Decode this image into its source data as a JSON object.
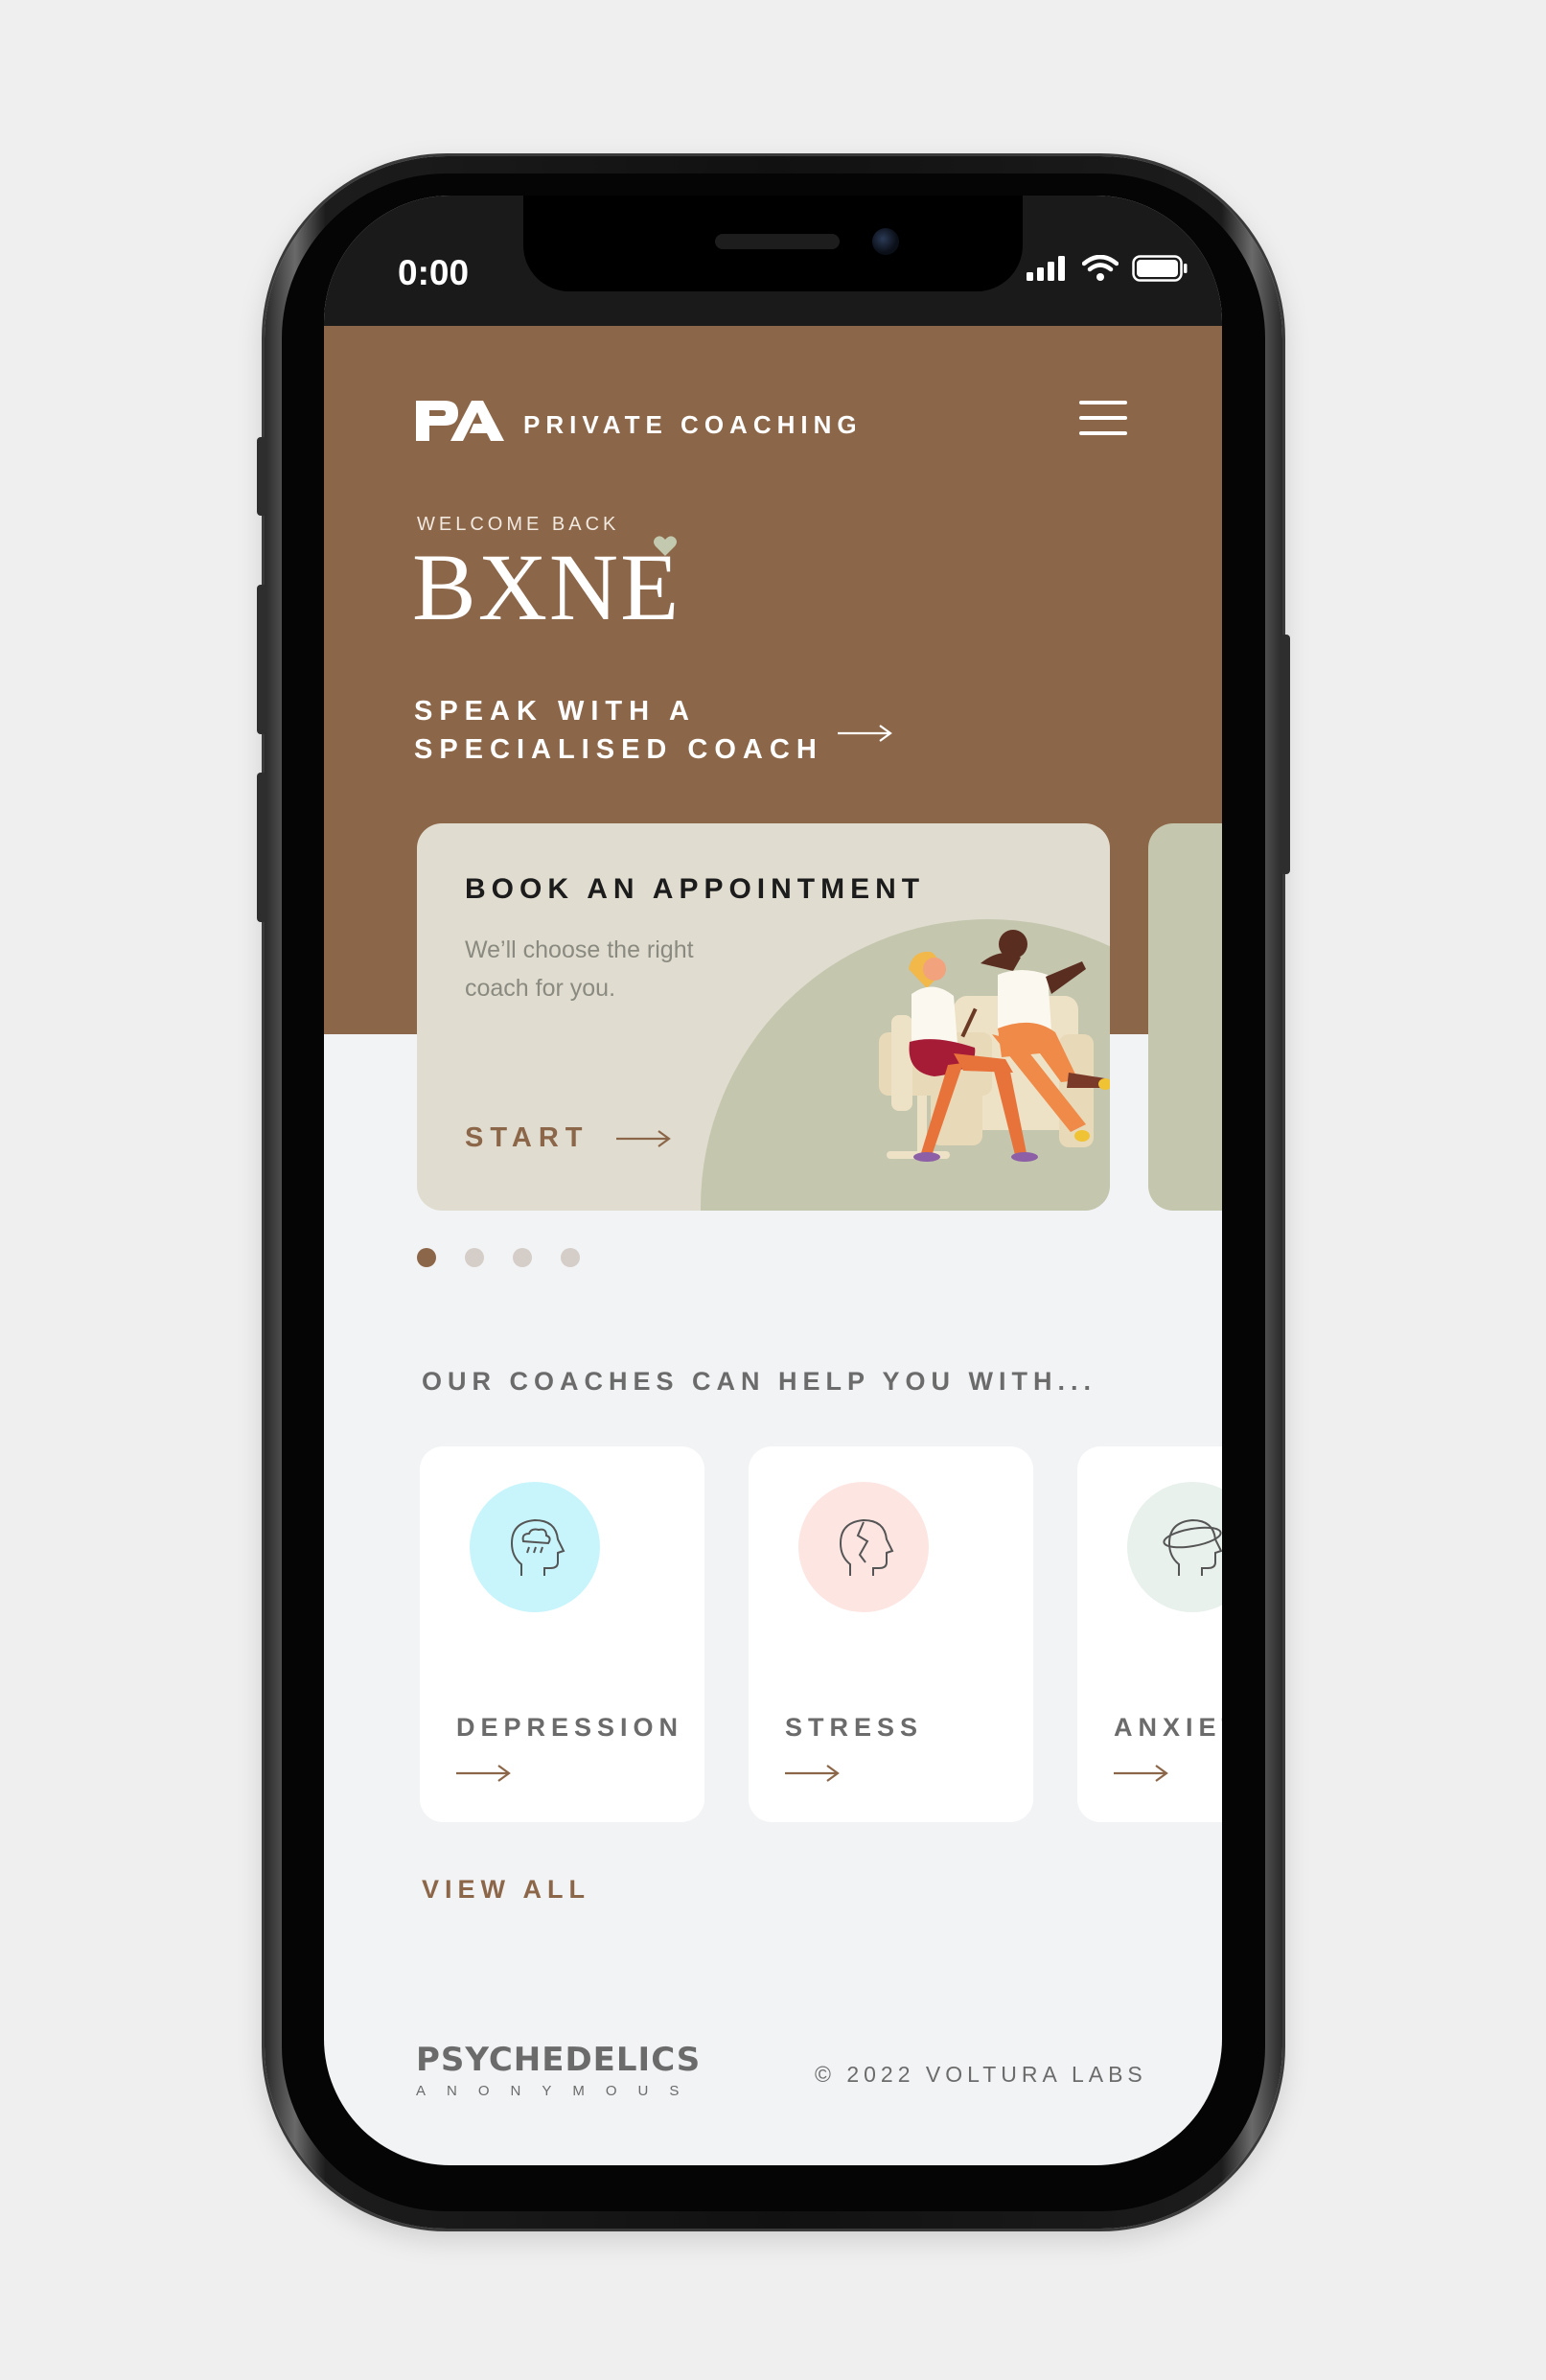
{
  "status_bar": {
    "time": "0:00"
  },
  "header": {
    "logo": "PA",
    "brand_title": "PRIVATE COACHING",
    "welcome": "WELCOME BACK",
    "user_name": "BXNE",
    "cta_line1": "SPEAK WITH A",
    "cta_line2": "SPECIALISED COACH"
  },
  "appointment_card": {
    "title": "BOOK AN APPOINTMENT",
    "subtitle": "We’ll choose the right coach for you.",
    "start_label": "START"
  },
  "carousel": {
    "pages": 4,
    "active": 0
  },
  "help_section": {
    "title": "OUR COACHES CAN HELP YOU WITH...",
    "topics": [
      {
        "label": "DEPRESSION",
        "color": "#c8f5fb",
        "icon": "head-cloud-icon"
      },
      {
        "label": "STRESS",
        "color": "#fde5e2",
        "icon": "head-crack-icon"
      },
      {
        "label": "ANXIETY",
        "color": "#e8f1ec",
        "icon": "head-orbit-icon"
      }
    ],
    "view_all": "VIEW ALL"
  },
  "footer": {
    "logo_main": "PSYCHEDELICS",
    "logo_sub": "ANONYMOUS",
    "copyright": "© 2022 VOLTURA LABS"
  },
  "colors": {
    "brand_brown": "#8c6648",
    "card_beige": "#e0ddd0",
    "sage": "#c4c6ae",
    "background": "#f2f3f5"
  }
}
